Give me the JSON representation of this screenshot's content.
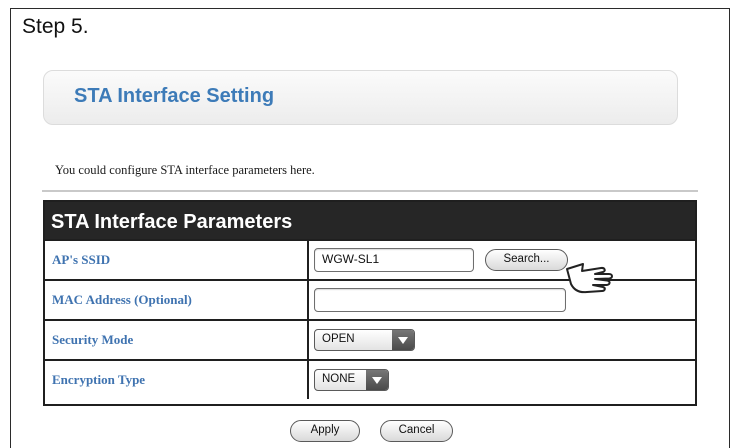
{
  "step_label": "Step 5.",
  "header": {
    "title": "STA Interface Setting"
  },
  "description": "You could configure STA interface parameters here.",
  "table": {
    "title": "STA Interface Parameters",
    "rows": [
      {
        "label": "AP's SSID",
        "value": "WGW-SL1",
        "button": "Search..."
      },
      {
        "label": "MAC Address (Optional)",
        "value": ""
      },
      {
        "label": "Security Mode",
        "selected": "OPEN"
      },
      {
        "label": "Encryption Type",
        "selected": "NONE"
      }
    ]
  },
  "actions": {
    "apply": "Apply",
    "cancel": "Cancel"
  },
  "colors": {
    "label_blue": "#3f73b0",
    "title_blue": "#3d7bb8",
    "table_header_bg": "#262626"
  },
  "icons": {
    "pointer": "hand-pointer-icon",
    "dropdown": "triangle-down-icon"
  }
}
